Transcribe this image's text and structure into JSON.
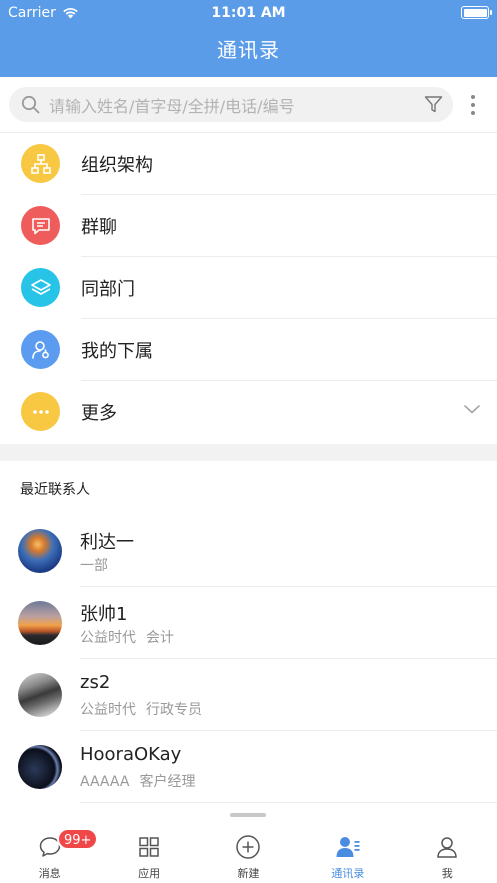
{
  "status_bar": {
    "carrier": "Carrier",
    "time": "11:01 AM"
  },
  "nav": {
    "title": "通讯录"
  },
  "search": {
    "placeholder": "请输入姓名/首字母/全拼/电话/编号"
  },
  "menu": [
    {
      "label": "组织架构",
      "icon": "org-chart-icon",
      "color": "#f9c842"
    },
    {
      "label": "群聊",
      "icon": "chat-group-icon",
      "color": "#ef5c5c"
    },
    {
      "label": "同部门",
      "icon": "layers-icon",
      "color": "#27c4e8"
    },
    {
      "label": "我的下属",
      "icon": "subordinate-icon",
      "color": "#5b9cf0"
    },
    {
      "label": "更多",
      "icon": "more-icon",
      "color": "#f9c842"
    }
  ],
  "recent": {
    "title": "最近联系人",
    "contacts": [
      {
        "name": "利达一",
        "dept": "一部",
        "role": ""
      },
      {
        "name": "张帅1",
        "dept": "公益时代",
        "role": "会计"
      },
      {
        "name": "zs2",
        "dept": "公益时代",
        "role": "行政专员"
      },
      {
        "name": "HooraOKay",
        "dept": "AAAAA",
        "role": "客户经理"
      }
    ]
  },
  "tabs": [
    {
      "label": "消息",
      "icon": "message-icon",
      "badge": "99+"
    },
    {
      "label": "应用",
      "icon": "apps-grid-icon"
    },
    {
      "label": "新建",
      "icon": "add-circle-icon"
    },
    {
      "label": "通讯录",
      "icon": "contacts-icon",
      "active": true
    },
    {
      "label": "我",
      "icon": "profile-icon"
    }
  ],
  "colors": {
    "primary": "#5a9ce8",
    "active_tab": "#4a8de0",
    "badge": "#f04848"
  }
}
